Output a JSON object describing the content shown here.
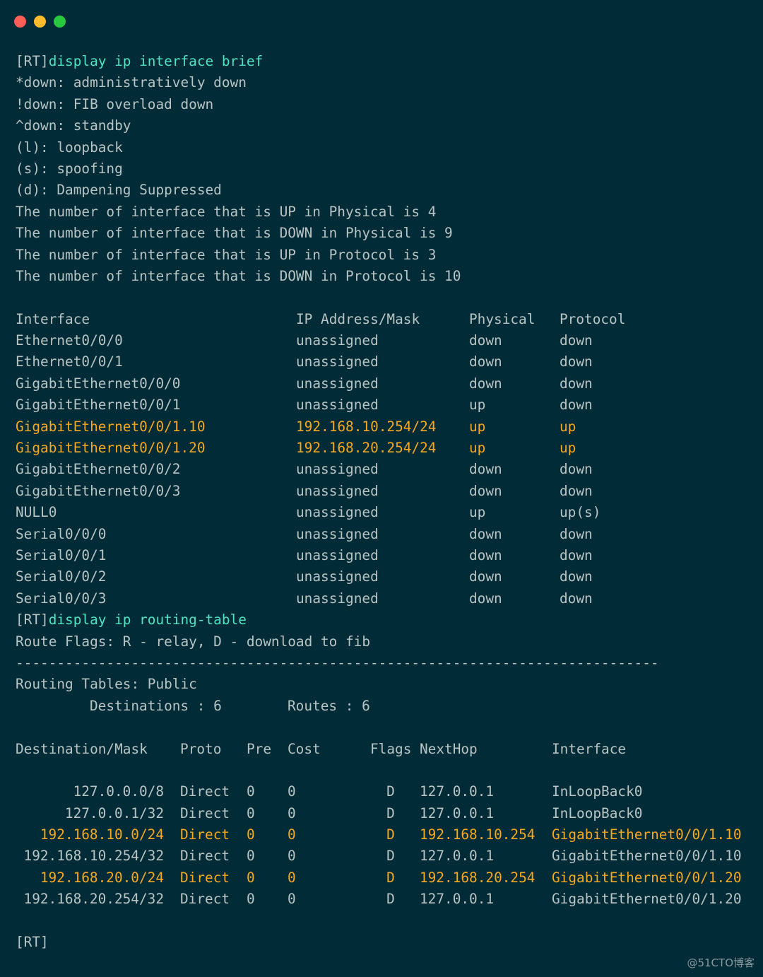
{
  "window": {
    "buttons": [
      "close",
      "minimize",
      "maximize"
    ]
  },
  "colors": {
    "background": "#012b36",
    "text": "#b9c4c4",
    "command": "#4fe3c3",
    "highlight": "#f6a821"
  },
  "prompt": "[RT]",
  "cmd1": "display ip interface brief",
  "legend": [
    "*down: administratively down",
    "!down: FIB overload down",
    "^down: standby",
    "(l): loopback",
    "(s): spoofing",
    "(d): Dampening Suppressed",
    "The number of interface that is UP in Physical is 4",
    "The number of interface that is DOWN in Physical is 9",
    "The number of interface that is UP in Protocol is 3",
    "The number of interface that is DOWN in Protocol is 10"
  ],
  "iface_table": {
    "headers": [
      "Interface",
      "IP Address/Mask",
      "Physical",
      "Protocol"
    ],
    "rows": [
      [
        "Ethernet0/0/0",
        "unassigned",
        "down",
        "down"
      ],
      [
        "Ethernet0/0/1",
        "unassigned",
        "down",
        "down"
      ],
      [
        "GigabitEthernet0/0/0",
        "unassigned",
        "down",
        "down"
      ],
      [
        "GigabitEthernet0/0/1",
        "unassigned",
        "up",
        "down"
      ],
      [
        "GigabitEthernet0/0/1.10",
        "192.168.10.254/24",
        "up",
        "up"
      ],
      [
        "GigabitEthernet0/0/1.20",
        "192.168.20.254/24",
        "up",
        "up"
      ],
      [
        "GigabitEthernet0/0/2",
        "unassigned",
        "down",
        "down"
      ],
      [
        "GigabitEthernet0/0/3",
        "unassigned",
        "down",
        "down"
      ],
      [
        "NULL0",
        "unassigned",
        "up",
        "up(s)"
      ],
      [
        "Serial0/0/0",
        "unassigned",
        "down",
        "down"
      ],
      [
        "Serial0/0/1",
        "unassigned",
        "down",
        "down"
      ],
      [
        "Serial0/0/2",
        "unassigned",
        "down",
        "down"
      ],
      [
        "Serial0/0/3",
        "unassigned",
        "down",
        "down"
      ]
    ],
    "highlighted_rows": [
      4,
      5
    ]
  },
  "cmd2": "display ip routing-table",
  "route_flags": "Route Flags: R - relay, D - download to fib",
  "separator": "------------------------------------------------------------------------------",
  "routing_tables": "Routing Tables: Public",
  "destinations_label": "Destinations : 6",
  "routes_label": "Routes : 6",
  "route_table": {
    "headers": [
      "Destination/Mask",
      "Proto",
      "Pre",
      "Cost",
      "Flags",
      "NextHop",
      "Interface"
    ],
    "rows": [
      [
        "127.0.0.0/8",
        "Direct",
        "0",
        "0",
        "D",
        "127.0.0.1",
        "InLoopBack0"
      ],
      [
        "127.0.0.1/32",
        "Direct",
        "0",
        "0",
        "D",
        "127.0.0.1",
        "InLoopBack0"
      ],
      [
        "192.168.10.0/24",
        "Direct",
        "0",
        "0",
        "D",
        "192.168.10.254",
        "GigabitEthernet0/0/1.10"
      ],
      [
        "192.168.10.254/32",
        "Direct",
        "0",
        "0",
        "D",
        "127.0.0.1",
        "GigabitEthernet0/0/1.10"
      ],
      [
        "192.168.20.0/24",
        "Direct",
        "0",
        "0",
        "D",
        "192.168.20.254",
        "GigabitEthernet0/0/1.20"
      ],
      [
        "192.168.20.254/32",
        "Direct",
        "0",
        "0",
        "D",
        "127.0.0.1",
        "GigabitEthernet0/0/1.20"
      ]
    ],
    "highlighted_rows": [
      2,
      4
    ]
  },
  "watermark": "@51CTO博客"
}
